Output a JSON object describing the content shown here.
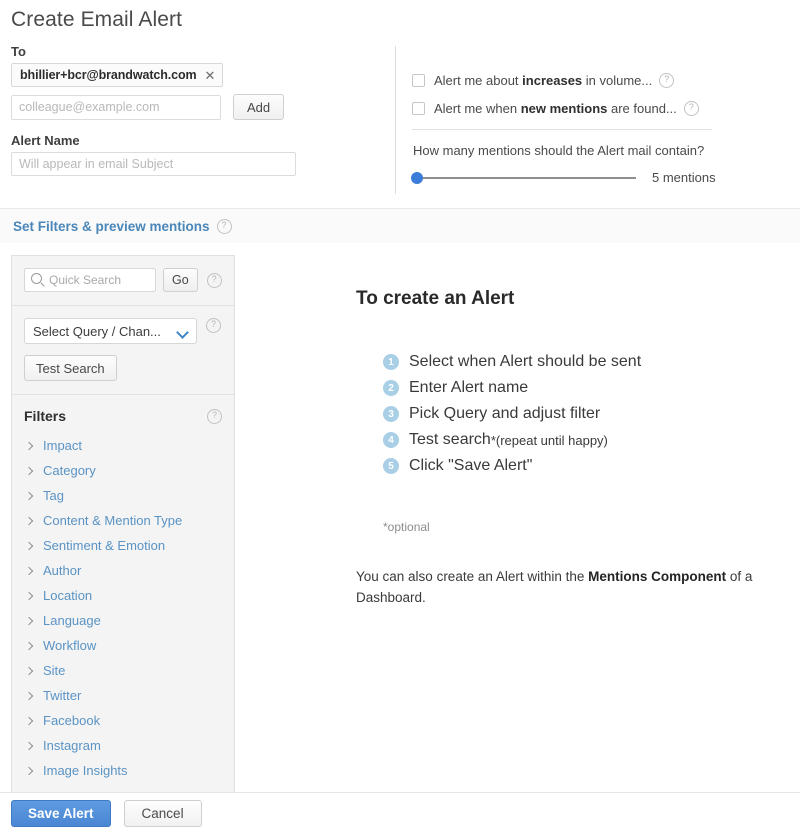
{
  "page_title": "Create Email Alert",
  "form": {
    "to_label": "To",
    "recipient_chip": "bhillier+bcr@brandwatch.com",
    "chip_remove_icon": "close-icon",
    "new_recipient_placeholder": "colleague@example.com",
    "new_recipient_value": "",
    "add_label": "Add",
    "alert_name_label": "Alert Name",
    "alert_name_placeholder": "Will appear in email Subject",
    "alert_name_value": ""
  },
  "options": {
    "checkbox_increases": {
      "prefix": "Alert me about ",
      "bold": "increases",
      "suffix": " in volume...",
      "checked": false,
      "help_icon": "help-icon"
    },
    "checkbox_new_mentions": {
      "prefix": "Alert me when ",
      "bold": "new mentions",
      "suffix": " are found...",
      "checked": false,
      "help_icon": "help-icon"
    },
    "slider": {
      "question": "How many mentions should the Alert mail contain?",
      "value_label": "5 mentions",
      "value": 5,
      "min": 5,
      "max": 1000,
      "thumb_color": "#3b7dd8"
    }
  },
  "section_bar": {
    "label": "Set Filters & preview mentions",
    "help_icon": "help-icon",
    "link_color": "#4a86b8"
  },
  "sidebar": {
    "search": {
      "placeholder": "Quick Search",
      "value": "",
      "icon": "search-icon",
      "go_label": "Go",
      "help_icon": "help-icon"
    },
    "query_select": {
      "selected": "Select Query / Chan...",
      "chevron_icon": "chevron-down-icon",
      "help_icon": "help-icon"
    },
    "test_search_label": "Test Search",
    "filters_title": "Filters",
    "filters_help_icon": "help-icon",
    "filters": [
      {
        "label": "Impact"
      },
      {
        "label": "Category"
      },
      {
        "label": "Tag"
      },
      {
        "label": "Content & Mention Type"
      },
      {
        "label": "Sentiment & Emotion"
      },
      {
        "label": "Author"
      },
      {
        "label": "Location"
      },
      {
        "label": "Language"
      },
      {
        "label": "Workflow"
      },
      {
        "label": "Site"
      },
      {
        "label": "Twitter"
      },
      {
        "label": "Facebook"
      },
      {
        "label": "Instagram"
      },
      {
        "label": "Image Insights"
      }
    ],
    "filter_link_color": "#5a93c4"
  },
  "main": {
    "heading": "To create an Alert",
    "steps": [
      {
        "num": "1",
        "text": "Select when Alert should be sent",
        "sub": ""
      },
      {
        "num": "2",
        "text": "Enter Alert name",
        "sub": ""
      },
      {
        "num": "3",
        "text": "Pick Query and adjust filter",
        "sub": ""
      },
      {
        "num": "4",
        "text": "Test search",
        "star": "*",
        "sub": "(repeat until happy)"
      },
      {
        "num": "5",
        "text": "Click \"Save Alert\"",
        "sub": ""
      }
    ],
    "step_circle_color": "#a9cfe6",
    "optional_note": "*optional",
    "closing": {
      "prefix": "You can also create an Alert within the ",
      "bold": "Mentions Component",
      "suffix": " of a Dashboard."
    }
  },
  "footer": {
    "save_label": "Save Alert",
    "cancel_label": "Cancel",
    "primary_color": "#4a86d4"
  }
}
